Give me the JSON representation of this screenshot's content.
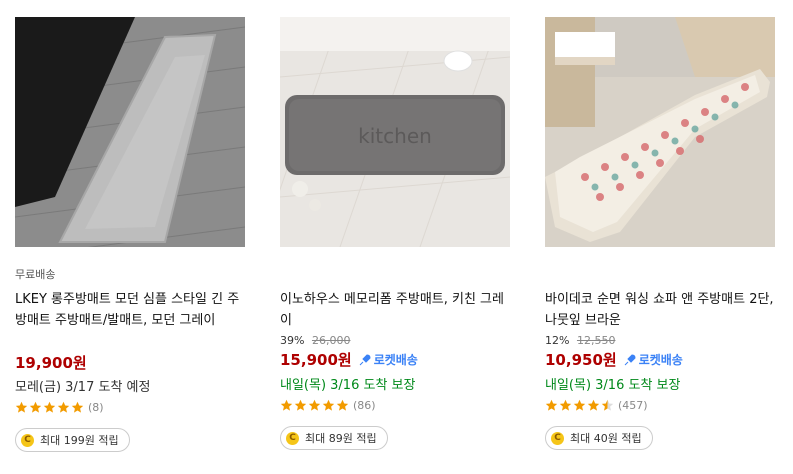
{
  "products": [
    {
      "free_shipping": "무료배송",
      "title": "LKEY 롱주방매트 모던 심플 스타일 긴 주방매트 주방매트/발매트, 모던 그레이",
      "price": "19,900원",
      "arrival": "모레(금) 3/17 도착 예정",
      "rating_count": "(8)",
      "rating": 5,
      "reward": "최대 199원 적립"
    },
    {
      "title": "이노하우스 메모리폼 주방매트, 키친 그레이",
      "discount_rate": "39%",
      "original_price": "26,000",
      "price": "15,900원",
      "rocket_label": "로켓배송",
      "arrival": "내일(목) 3/16 도착 보장",
      "rating_count": "(86)",
      "rating": 5,
      "reward": "최대 89원 적립",
      "mat_text": "kitchen"
    },
    {
      "title": "바이데코 순면 워싱 쇼파 앤 주방매트 2단, 나뭇잎 브라운",
      "discount_rate": "12%",
      "original_price": "12,550",
      "price": "10,950원",
      "rocket_label": "로켓배송",
      "arrival": "내일(목) 3/16 도착 보장",
      "rating_count": "(457)",
      "rating": 4.5,
      "reward": "최대 40원 적립"
    }
  ],
  "colors": {
    "price": "#ae0000",
    "rocket": "#3b82f6",
    "arrival_green": "#00891a",
    "star": "#f29b00",
    "coin": "#f5c518"
  }
}
